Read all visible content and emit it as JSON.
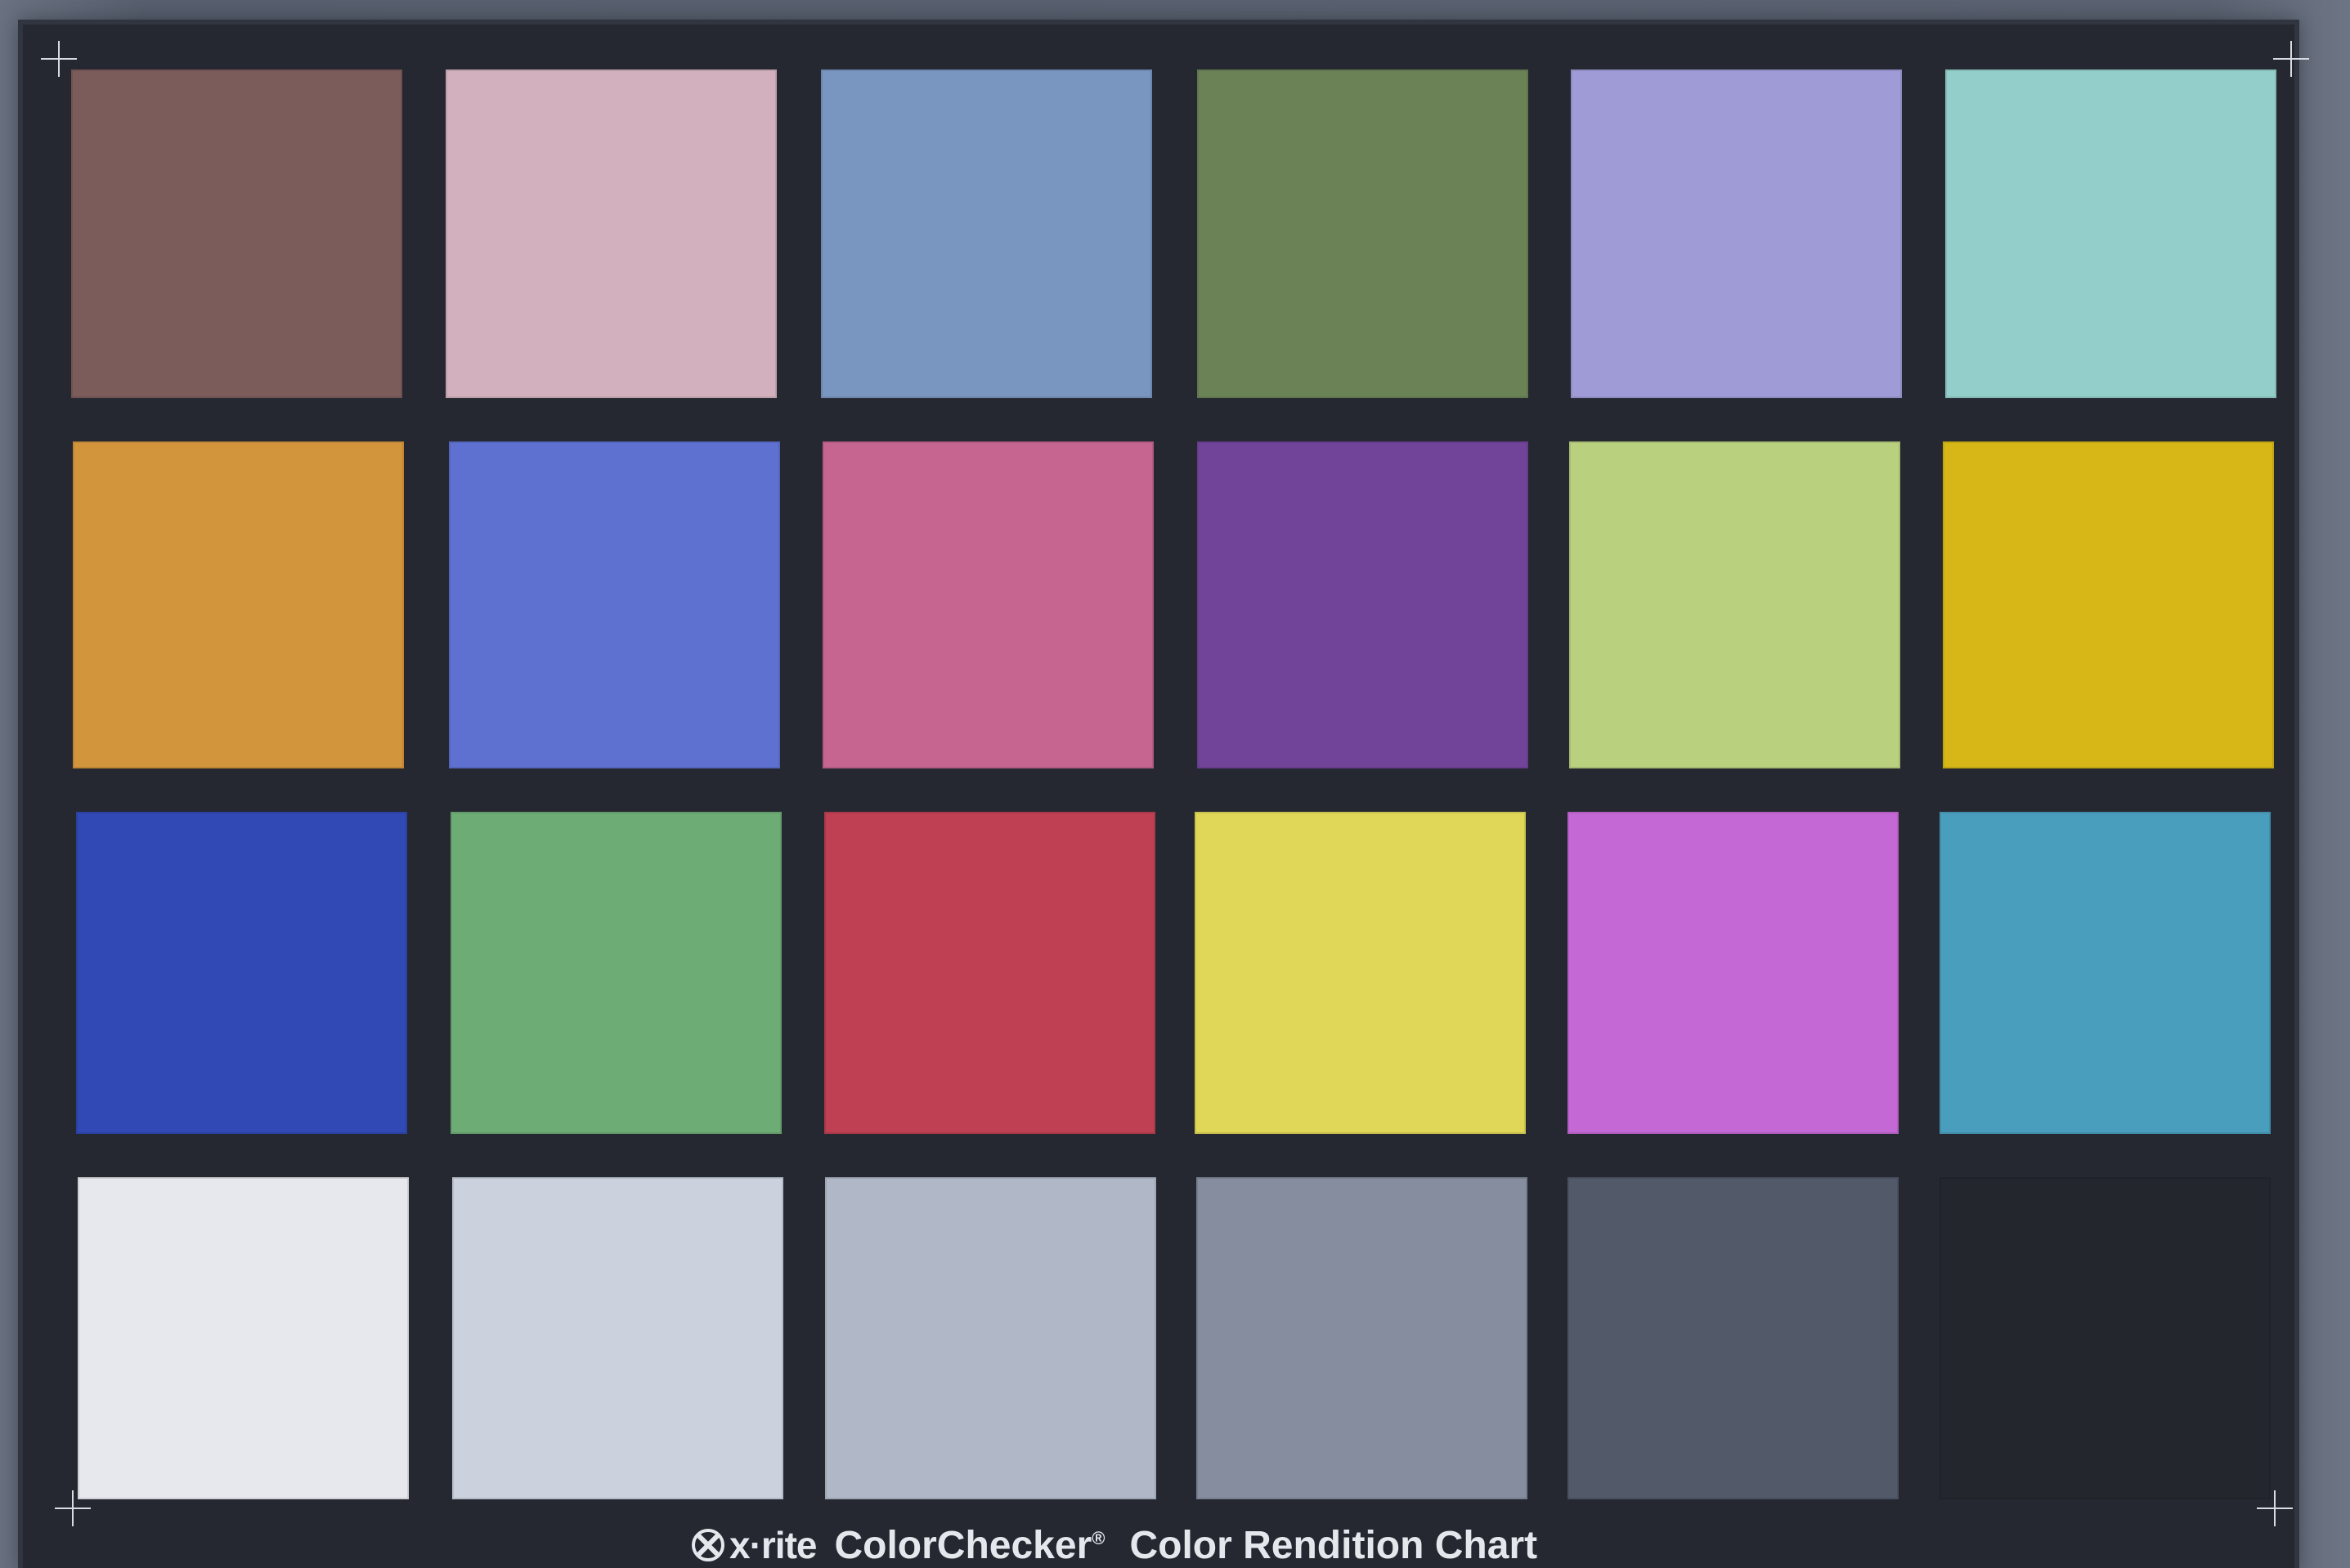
{
  "footer": {
    "brand": "x·rite",
    "product": "ColorChecker",
    "registered": "®",
    "subtitle": "Color Rendition Chart"
  },
  "patches": [
    [
      "#7c5b5b",
      "#d2b0bd",
      "#7996c0",
      "#6b8257",
      "#9f9bd6",
      "#93ceca"
    ],
    [
      "#d3953c",
      "#5e71d1",
      "#c66690",
      "#71449a",
      "#b9d07f",
      "#d6b717"
    ],
    [
      "#3049b4",
      "#6eac75",
      "#bf4052",
      "#e0d657",
      "#c468d5",
      "#4a9ebd"
    ],
    [
      "#e6e8ee",
      "#cbd2de",
      "#b0b8c8",
      "#858d9e",
      "#525a6a",
      "#23262d"
    ]
  ],
  "colors": {
    "card": "#252830",
    "background": "#5f6776",
    "marks": "#d7dbe2",
    "text": "#e4e7ec"
  }
}
